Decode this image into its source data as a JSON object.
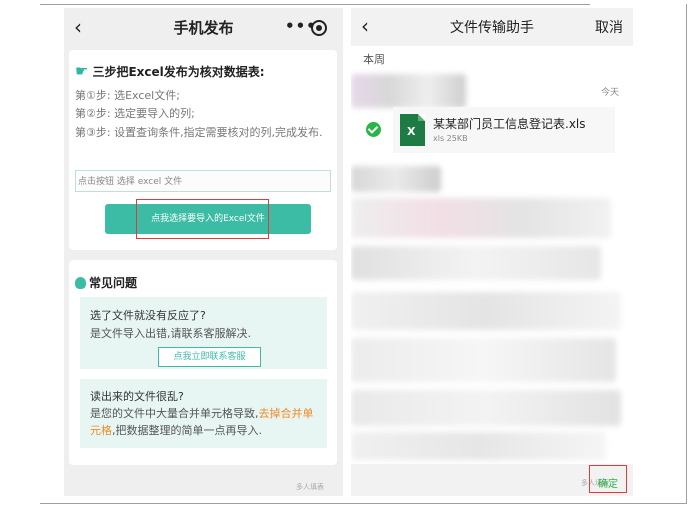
{
  "left": {
    "title": "手机发布",
    "back_icon": "‹",
    "more_icon": "•••",
    "card1": {
      "heading": "三步把Excel发布为核对数据表:",
      "steps": [
        "第①步: 选Excel文件;",
        "第②步: 选定要导入的列;",
        "第③步: 设置查询条件,指定需要核对的列,完成发布."
      ],
      "file_input_text": "点击按钮 选择 excel 文件",
      "pick_button": "点我选择要导入的Excel文件"
    },
    "faq": {
      "heading": "常见问题",
      "q1": "选了文件就没有反应了?",
      "a1": "是文件导入出错,请联系客服解决.",
      "contact_button": "点我立即联系客服",
      "q2": "读出来的文件很乱?",
      "a2_before": "是您的文件中大量合并单元格导致,",
      "a2_highlight": "去掉合并单元格",
      "a2_after": ",把数据整理的简单一点再导入."
    },
    "watermark": "多人填表"
  },
  "right": {
    "title": "文件传输助手",
    "back_icon": "‹",
    "cancel": "取消",
    "section": "本周",
    "today": "今天",
    "file": {
      "name": "某某部门员工信息登记表.xls",
      "meta": "xls 25KB",
      "icon_letter": "X"
    },
    "confirm": "确定",
    "watermark": "多人填表"
  },
  "colors": {
    "accent": "#3cbca5",
    "highlight": "#e03a3a",
    "orange": "#f08a24",
    "excel": "#1d7b44",
    "wechat_green": "#29b548"
  }
}
